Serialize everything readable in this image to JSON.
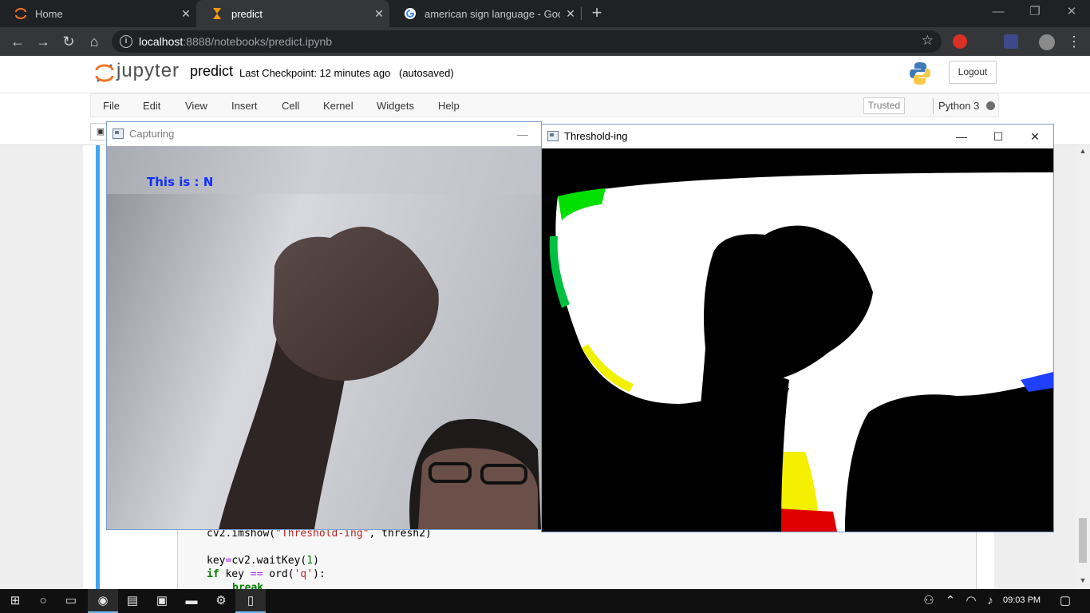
{
  "browser": {
    "tabs": [
      {
        "label": "Home",
        "active": false,
        "favicon": "jupyter-icon"
      },
      {
        "label": "predict",
        "active": true,
        "favicon": "hourglass-icon"
      },
      {
        "label": "american sign language - Google",
        "active": false,
        "favicon": "google-icon"
      }
    ],
    "close_glyph": "✕",
    "new_tab_glyph": "+",
    "url_host": "localhost",
    "url_rest": ":8888/notebooks/predict.ipynb"
  },
  "jupyter": {
    "logo_text": "jupyter",
    "notebook_name": "predict",
    "checkpoint": "Last Checkpoint: 12 minutes ago",
    "autosave": "(autosaved)",
    "logout_label": "Logout",
    "menu": [
      "File",
      "Edit",
      "View",
      "Insert",
      "Cell",
      "Kernel",
      "Widgets",
      "Help"
    ],
    "trusted_label": "Trusted",
    "kernel_name": "Python 3"
  },
  "code": {
    "line1": {
      "fn": "cv2.imshow(",
      "arg": "\"Threshold-ing\"",
      "rest": ", thresh2)"
    },
    "line2": {
      "lhs": "key",
      "eq": "=",
      "fn": "cv2.waitKey(",
      "num": "1",
      "close": ")"
    },
    "line3": {
      "kw": "if",
      "mid": " key ",
      "op": "==",
      "fn": " ord(",
      "arg": "'q'",
      "close": "):"
    },
    "line4": {
      "kw": "break"
    }
  },
  "windows": {
    "capturing": {
      "title": "Capturing",
      "overlay_text": "This is : N",
      "minimize_glyph": "—"
    },
    "threshold": {
      "title": "Threshold-ing",
      "minimize_glyph": "—",
      "maximize_glyph": "☐",
      "close_glyph": "✕"
    }
  },
  "taskbar": {
    "time": "09:03 PM"
  },
  "colors": {
    "chrome_dark": "#202124",
    "chrome_toolbar": "#35363a",
    "jupyter_orange": "#f37626",
    "cell_selected": "#42a5f5",
    "overlay_text": "#1030ff"
  }
}
